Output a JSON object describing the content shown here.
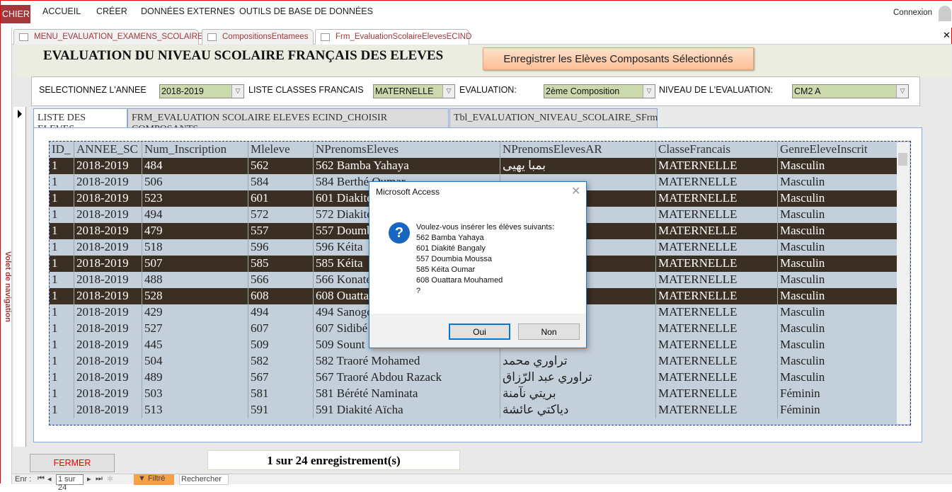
{
  "ribbon": {
    "tabs": [
      "CHIER",
      "ACCUEIL",
      "CRÉER",
      "DONNÉES EXTERNES",
      "OUTILS DE BASE DE DONNÉES"
    ],
    "account": "Connexion"
  },
  "doc_tabs": [
    "MENU_EVALUATION_EXAMENS_SCOLAIRES",
    "CompositionsEntamees",
    "Frm_EvaluationScolaireElevesECIND"
  ],
  "nav_pane_label": "Volet de navigation",
  "form": {
    "title": "EVALUATION DU NIVEAU SCOLAIRE FRANÇAIS DES ELEVES",
    "save_button": "Enregistrer les Elèves Composants Sélectionnés",
    "filters": [
      {
        "label": "SELECTIONNEZ L'ANNEE",
        "value": "2018-2019"
      },
      {
        "label": "LISTE CLASSES FRANCAIS",
        "value": "MATERNELLE"
      },
      {
        "label": "EVALUATION:",
        "value": "2ème Composition"
      },
      {
        "label": "NIVEAU DE L'EVALUATION:",
        "value": "CM2 A"
      }
    ],
    "tabs": [
      "LISTE DES ELEVES",
      "FRM_EVALUATION SCOLAIRE ELEVES ECIND_CHOISIR COMPOSANTS",
      "Tbl_EVALUATION_NIVEAU_SCOLAIRE_SFrm"
    ],
    "table": {
      "columns": [
        "ID_",
        "ANNEE_SC",
        "Num_Inscription",
        "Mleleve",
        "NPrenomsEleves",
        "NPrenomsElevesAR",
        "ClasseFrancais",
        "GenreEleveInscrit"
      ],
      "rows": [
        [
          "1",
          "2018-2019",
          "484",
          "562",
          "562 Bamba Yahaya",
          "بمبا يهيى",
          "MATERNELLE",
          "Masculin"
        ],
        [
          "1",
          "2018-2019",
          "506",
          "584",
          "584 Berthé Oumar",
          "",
          "MATERNELLE",
          "Masculin"
        ],
        [
          "1",
          "2018-2019",
          "523",
          "601",
          "601 Diakité",
          "",
          "MATERNELLE",
          "Masculin"
        ],
        [
          "1",
          "2018-2019",
          "494",
          "572",
          "572 Diakité",
          "",
          "MATERNELLE",
          "Masculin"
        ],
        [
          "1",
          "2018-2019",
          "479",
          "557",
          "557 Doumbia",
          "",
          "MATERNELLE",
          "Masculin"
        ],
        [
          "1",
          "2018-2019",
          "518",
          "596",
          "596 Kéita",
          "",
          "MATERNELLE",
          "Masculin"
        ],
        [
          "1",
          "2018-2019",
          "507",
          "585",
          "585 Kéita",
          "",
          "MATERNELLE",
          "Masculin"
        ],
        [
          "1",
          "2018-2019",
          "488",
          "566",
          "566 Konaté",
          "",
          "MATERNELLE",
          "Masculin"
        ],
        [
          "1",
          "2018-2019",
          "528",
          "608",
          "608 Ouattara",
          "",
          "MATERNELLE",
          "Masculin"
        ],
        [
          "1",
          "2018-2019",
          "429",
          "494",
          "494 Sanogo",
          "",
          "MATERNELLE",
          "Masculin"
        ],
        [
          "1",
          "2018-2019",
          "527",
          "607",
          "607 Sidibé",
          "",
          "MATERNELLE",
          "Masculin"
        ],
        [
          "1",
          "2018-2019",
          "445",
          "509",
          "509 Sount",
          "",
          "MATERNELLE",
          "Masculin"
        ],
        [
          "1",
          "2018-2019",
          "504",
          "582",
          "582 Traoré Mohamed",
          "تراوري محمد",
          "MATERNELLE",
          "Masculin"
        ],
        [
          "1",
          "2018-2019",
          "489",
          "567",
          "567 Traoré Abdou Razack",
          "تراوري عبد الرّزاق",
          "MATERNELLE",
          "Masculin"
        ],
        [
          "1",
          "2018-2019",
          "503",
          "581",
          "581 Bérété Naminata",
          "بريتي نآمنة",
          "MATERNELLE",
          "Féminin"
        ],
        [
          "1",
          "2018-2019",
          "513",
          "591",
          "591 Diakité Aïcha",
          "دياكتي عائشة",
          "MATERNELLE",
          "Féminin"
        ]
      ],
      "selected_rows": [
        0,
        2,
        4,
        6,
        8
      ]
    },
    "close_button": "FERMER",
    "record_count": "1 sur 24 enregistrement(s)"
  },
  "record_nav": {
    "label": "Enr :",
    "position": "1 sur 24",
    "filter": "Filtré",
    "search": "Rechercher"
  },
  "dialog": {
    "title": "Microsoft Access",
    "icon": "question-icon",
    "message": [
      "Voulez-vous insérer les élèves suivants:",
      "562 Bamba Yahaya",
      "601 Diakité Bangaly",
      "557 Doumbia Moussa",
      "585 Kéita Oumar",
      "608 Ouattara Mouhamed",
      "?"
    ],
    "yes": "Oui",
    "no": "Non"
  },
  "colors": {
    "accent": "#a4373a",
    "selected_row": "#3b2e23",
    "row": "#c3cfdb",
    "combo": "#cbd9ad"
  }
}
